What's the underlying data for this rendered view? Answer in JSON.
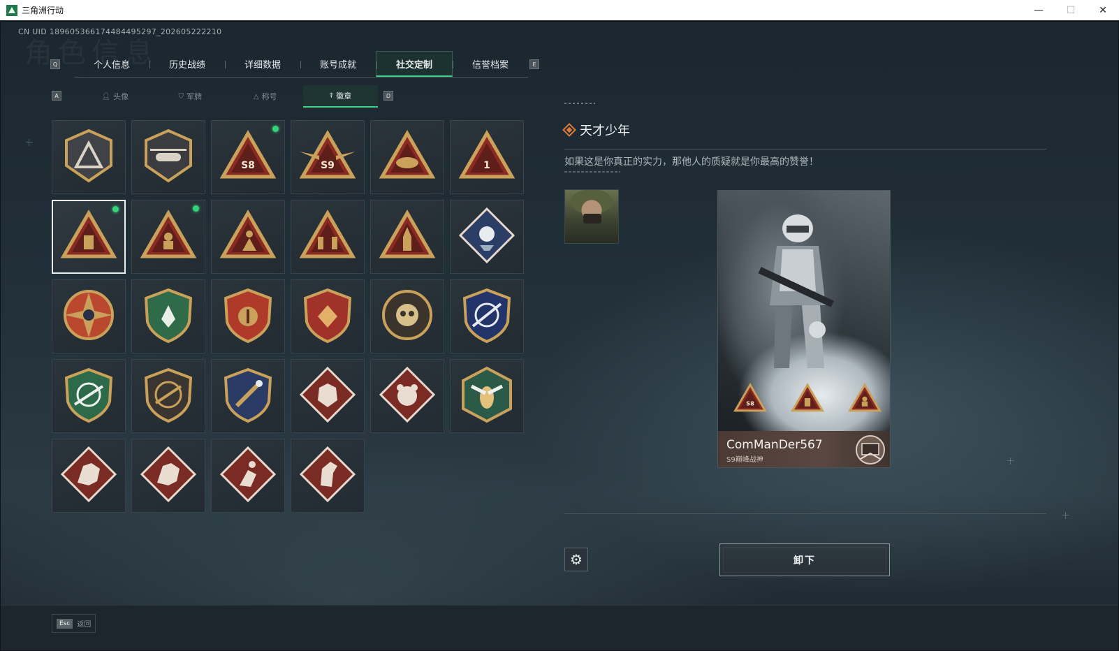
{
  "window": {
    "title": "三角洲行动",
    "minimize": "—",
    "maximize": "☐",
    "close": "✕"
  },
  "header": {
    "uid": "CN UID 18960536617448449529​7_202605222210",
    "bg_title": "角色信息"
  },
  "key_hints": {
    "tab_prev": "Q",
    "tab_next": "E",
    "sub_prev": "A",
    "sub_next": "D"
  },
  "tabs": [
    {
      "label": "个人信息"
    },
    {
      "label": "历史战绩"
    },
    {
      "label": "详细数据"
    },
    {
      "label": "账号成就"
    },
    {
      "label": "社交定制",
      "active": true
    },
    {
      "label": "信誉档案"
    }
  ],
  "subtabs": [
    {
      "label": "头像",
      "icon": "person-icon"
    },
    {
      "label": "军牌",
      "icon": "dogtag-icon"
    },
    {
      "label": "称号",
      "icon": "title-icon"
    },
    {
      "label": "徽章",
      "icon": "badge-icon",
      "active": true
    }
  ],
  "badges": [
    {
      "icon": "triangle-shield-badge-icon",
      "equipped": false
    },
    {
      "icon": "helicopter-shield-badge-icon",
      "equipped": false
    },
    {
      "icon": "s8-triangle-badge-icon",
      "equipped": true,
      "text": "S8"
    },
    {
      "icon": "s9-winged-triangle-badge-icon",
      "equipped": false,
      "text": "S9"
    },
    {
      "icon": "wings-triangle-badge-icon",
      "equipped": false
    },
    {
      "icon": "number-one-triangle-badge-icon",
      "equipped": false,
      "text": "1"
    },
    {
      "icon": "usb-triangle-badge-icon",
      "equipped": true,
      "selected": true
    },
    {
      "icon": "soldier-triangle-badge-icon",
      "equipped": true
    },
    {
      "icon": "kneeling-figure-triangle-badge-icon",
      "equipped": false
    },
    {
      "icon": "squad-triangle-badge-icon",
      "equipped": false
    },
    {
      "icon": "rocket-triangle-badge-icon",
      "equipped": false
    },
    {
      "icon": "rose-diamond-badge-icon",
      "equipped": false
    },
    {
      "icon": "compass-star-badge-icon",
      "equipped": false
    },
    {
      "icon": "green-star-shield-badge-icon",
      "equipped": false
    },
    {
      "icon": "gold-laurel-shield-badge-icon",
      "equipped": false
    },
    {
      "icon": "red-gem-shield-badge-icon",
      "equipped": false
    },
    {
      "icon": "skull-round-badge-icon",
      "equipped": false
    },
    {
      "icon": "blue-sniper-shield-badge-icon",
      "equipped": false
    },
    {
      "icon": "green-crosshair-shield-badge-icon",
      "equipped": false
    },
    {
      "icon": "rifle-round-shield-badge-icon",
      "equipped": false
    },
    {
      "icon": "dagger-gold-shield-badge-icon",
      "equipped": false
    },
    {
      "icon": "wolf-diamond-badge-icon",
      "equipped": false
    },
    {
      "icon": "bear-diamond-badge-icon",
      "equipped": false
    },
    {
      "icon": "wasp-hexagon-badge-icon",
      "equipped": false
    },
    {
      "icon": "dragon-diamond-badge-icon",
      "equipped": false
    },
    {
      "icon": "dragon-diamond-badge-icon",
      "equipped": false
    },
    {
      "icon": "runner-diamond-badge-icon",
      "equipped": false
    },
    {
      "icon": "horse-diamond-badge-icon",
      "equipped": false
    }
  ],
  "detail": {
    "badge_title": "天才少年",
    "badge_description": "如果这是你真正的实力，那他人的质疑就是你最高的赞誉！",
    "card": {
      "player_name": "ComManDer567",
      "player_rank": "S9巅峰战神",
      "badge_labels": [
        "S8"
      ]
    },
    "unequip_label": "卸下",
    "settings_icon": "gear-icon"
  },
  "footer": {
    "esc_key": "Esc",
    "esc_label": "返回"
  },
  "colors": {
    "accent": "#40d18a",
    "equipped_dot": "#35d27c",
    "title_diamond": "#e07b3a",
    "badge_gold": "#c9a15a",
    "badge_red": "#8a2a22"
  }
}
